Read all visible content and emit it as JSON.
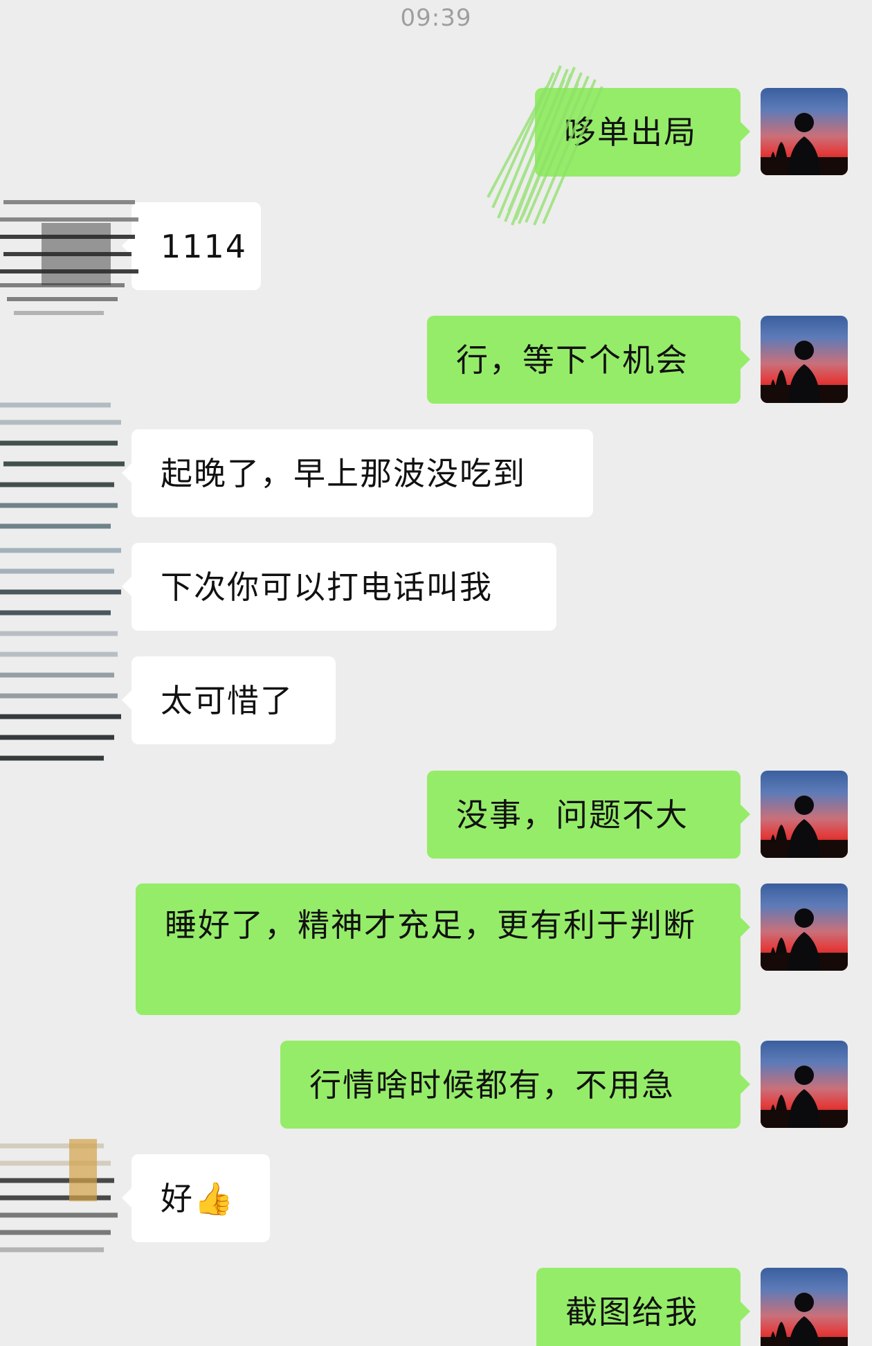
{
  "chat": {
    "timestamp": "09:39",
    "messages": [
      {
        "side": "right",
        "text": "哆单出局"
      },
      {
        "side": "left",
        "text": "1114"
      },
      {
        "side": "right",
        "text": "行，等下个机会"
      },
      {
        "side": "left",
        "text": "起晚了，早上那波没吃到"
      },
      {
        "side": "left",
        "text": "下次你可以打电话叫我"
      },
      {
        "side": "left",
        "text": "太可惜了"
      },
      {
        "side": "right",
        "text": "没事，问题不大"
      },
      {
        "side": "right",
        "text": "睡好了，精神才充足，更有利于判断"
      },
      {
        "side": "right",
        "text": "行情啥时候都有，不用急"
      },
      {
        "side": "left",
        "text": "好👍"
      },
      {
        "side": "right",
        "text": "截图给我"
      }
    ]
  },
  "icons": {
    "self_avatar": "avatar-silhouette-sunset-icon",
    "other_avatar": "avatar-redacted-scribble",
    "thumbs_up": "thumbs-up-emoji"
  },
  "colors": {
    "background": "#ededed",
    "sent_bubble": "#95ec69",
    "received_bubble": "#ffffff",
    "timestamp": "#9e9e9e"
  }
}
